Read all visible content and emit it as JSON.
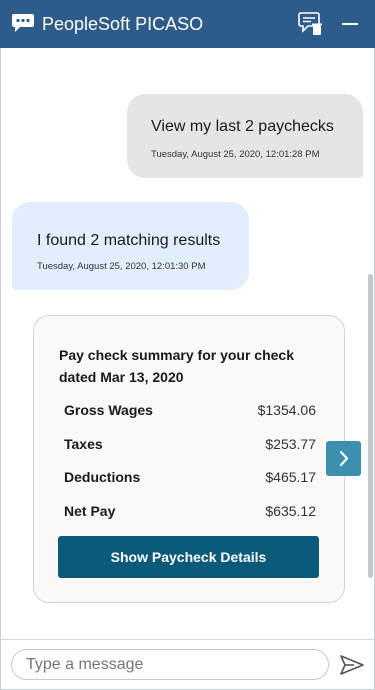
{
  "header": {
    "title": "PeopleSoft PICASO"
  },
  "conversation": {
    "user_message": {
      "text": "View my last 2 paychecks",
      "timestamp": "Tuesday, August 25, 2020, 12:01:28 PM"
    },
    "bot_message": {
      "text": "I found 2 matching results",
      "timestamp": "Tuesday, August 25, 2020, 12:01:30 PM"
    }
  },
  "paycheck_card": {
    "title": "Pay check summary for your check dated Mar 13, 2020",
    "rows": [
      {
        "label": "Gross Wages",
        "value": "$1354.06"
      },
      {
        "label": "Taxes",
        "value": "$253.77"
      },
      {
        "label": "Deductions",
        "value": "$465.17"
      },
      {
        "label": "Net Pay",
        "value": "$635.12"
      }
    ],
    "button_label": "Show Paycheck Details"
  },
  "composer": {
    "placeholder": "Type a message"
  }
}
